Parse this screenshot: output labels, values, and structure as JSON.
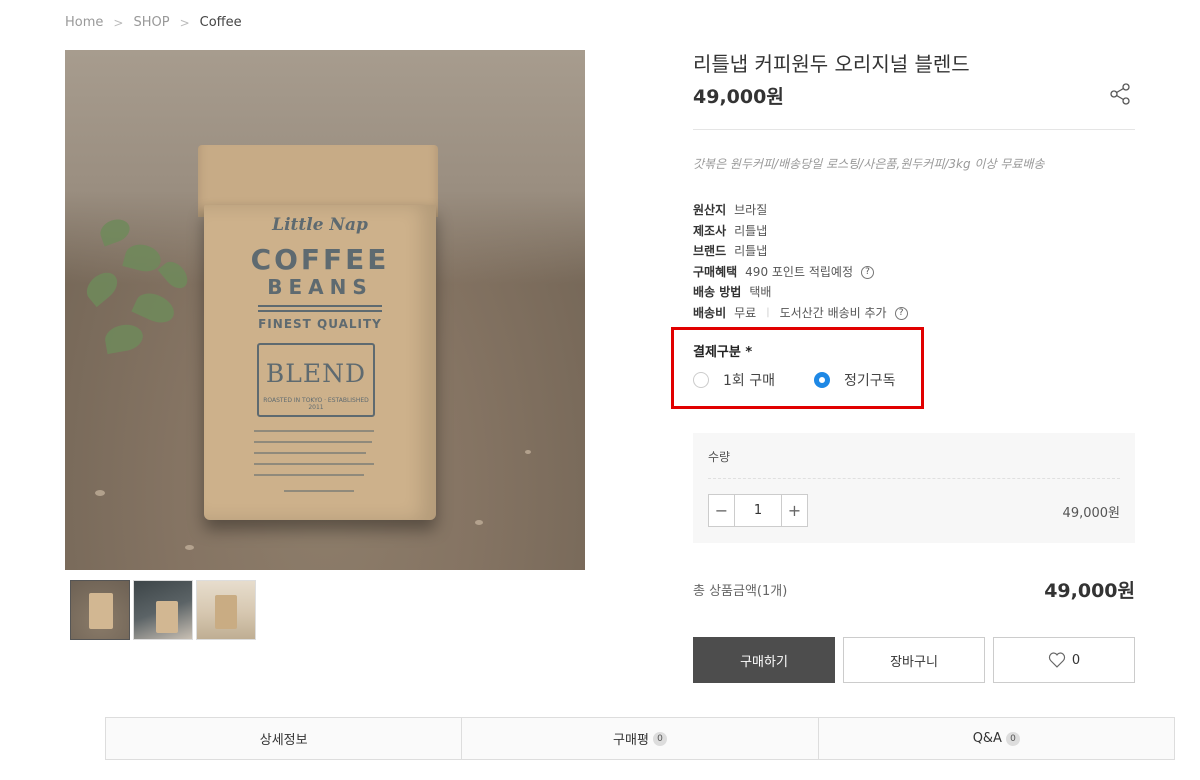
{
  "breadcrumb": {
    "items": [
      "Home",
      "SHOP",
      "Coffee"
    ],
    "separator": ">"
  },
  "product_image": {
    "bag_text": {
      "brand": "Little Nap",
      "line1": "COFFEE",
      "line2": "BEANS",
      "quality": "FINEST QUALITY",
      "blend": "BLEND",
      "roast": "ROASTED IN TOKYO · ESTABLISHED 2011"
    }
  },
  "product": {
    "title": "리틀냅 커피원두 오리지널 블렌드",
    "price": "49,000원",
    "summary": "갓볶은 원두커피/배송당일 로스팅/사은품,원두커피/3kg 이상 무료배송",
    "info": {
      "origin_label": "원산지",
      "origin_value": "브라질",
      "maker_label": "제조사",
      "maker_value": "리틀냅",
      "brand_label": "브랜드",
      "brand_value": "리틀냅",
      "benefit_label": "구매혜택",
      "benefit_value": "490 포인트 적립예정",
      "shipping_method_label": "배송 방법",
      "shipping_method_value": "택배",
      "shipping_fee_label": "배송비",
      "shipping_fee_value": "무료",
      "shipping_fee_divider": "|",
      "shipping_fee_extra": "도서산간 배송비 추가"
    }
  },
  "payment_type": {
    "label": "결제구분 *",
    "options": [
      "1회 구매",
      "정기구독"
    ],
    "selected": "정기구독",
    "selected_color": "#1e88e5",
    "highlight_color": "#e10000"
  },
  "quantity": {
    "label": "수량",
    "value": "1",
    "minus": "−",
    "plus": "+",
    "line_price": "49,000원"
  },
  "total": {
    "label": "총 상품금액(1개)",
    "price": "49,000원"
  },
  "actions": {
    "buy": "구매하기",
    "cart": "장바구니",
    "like_count": "0"
  },
  "tabs": [
    {
      "label": "상세정보"
    },
    {
      "label": "구매평",
      "badge": "0"
    },
    {
      "label": "Q&A",
      "badge": "0"
    }
  ],
  "icons": {
    "share": "share-icon",
    "help": "question-circle-icon",
    "heart": "heart-outline-icon",
    "chevron": "chevron-right-icon",
    "minus": "minus-icon",
    "plus": "plus-icon"
  }
}
